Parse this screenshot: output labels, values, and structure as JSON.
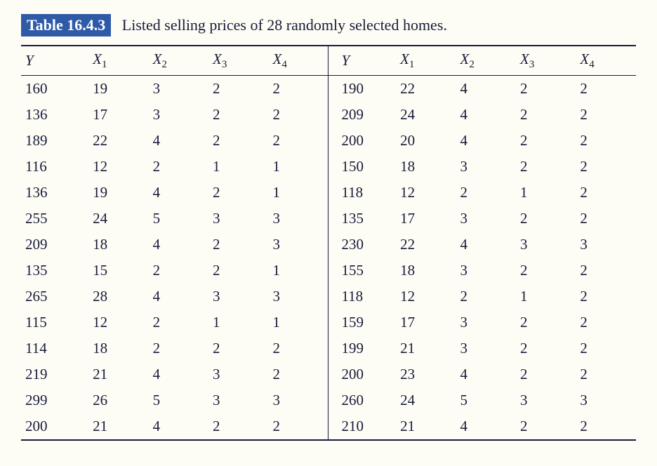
{
  "table_label": "Table 16.4.3",
  "caption": "Listed selling prices of 28 randomly selected homes.",
  "headers": {
    "y": "Y",
    "x1_base": "X",
    "x1_sub": "1",
    "x2_base": "X",
    "x2_sub": "2",
    "x3_base": "X",
    "x3_sub": "3",
    "x4_base": "X",
    "x4_sub": "4"
  },
  "chart_data": {
    "type": "table",
    "columns": [
      "Y",
      "X1",
      "X2",
      "X3",
      "X4"
    ],
    "left_rows": [
      [
        160,
        19,
        3,
        2,
        2
      ],
      [
        136,
        17,
        3,
        2,
        2
      ],
      [
        189,
        22,
        4,
        2,
        2
      ],
      [
        116,
        12,
        2,
        1,
        1
      ],
      [
        136,
        19,
        4,
        2,
        1
      ],
      [
        255,
        24,
        5,
        3,
        3
      ],
      [
        209,
        18,
        4,
        2,
        3
      ],
      [
        135,
        15,
        2,
        2,
        1
      ],
      [
        265,
        28,
        4,
        3,
        3
      ],
      [
        115,
        12,
        2,
        1,
        1
      ],
      [
        114,
        18,
        2,
        2,
        2
      ],
      [
        219,
        21,
        4,
        3,
        2
      ],
      [
        299,
        26,
        5,
        3,
        3
      ],
      [
        200,
        21,
        4,
        2,
        2
      ]
    ],
    "right_rows": [
      [
        190,
        22,
        4,
        2,
        2
      ],
      [
        209,
        24,
        4,
        2,
        2
      ],
      [
        200,
        20,
        4,
        2,
        2
      ],
      [
        150,
        18,
        3,
        2,
        2
      ],
      [
        118,
        12,
        2,
        1,
        2
      ],
      [
        135,
        17,
        3,
        2,
        2
      ],
      [
        230,
        22,
        4,
        3,
        3
      ],
      [
        155,
        18,
        3,
        2,
        2
      ],
      [
        118,
        12,
        2,
        1,
        2
      ],
      [
        159,
        17,
        3,
        2,
        2
      ],
      [
        199,
        21,
        3,
        2,
        2
      ],
      [
        200,
        23,
        4,
        2,
        2
      ],
      [
        260,
        24,
        5,
        3,
        3
      ],
      [
        210,
        21,
        4,
        2,
        2
      ]
    ]
  }
}
